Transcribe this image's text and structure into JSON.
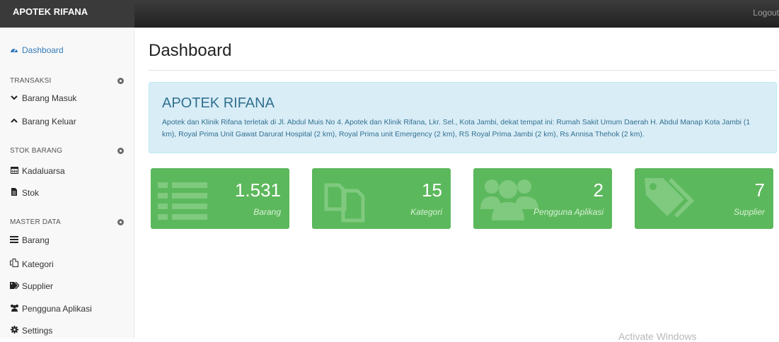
{
  "navbar": {
    "brand": "APOTEK RIFANA",
    "logout": "Logout"
  },
  "sidebar": {
    "dashboard": "Dashboard",
    "sections": [
      {
        "heading": "TRANSAKSI",
        "items": [
          "Barang Masuk",
          "Barang Keluar"
        ]
      },
      {
        "heading": "STOK BARANG",
        "items": [
          "Kadaluarsa",
          "Stok"
        ]
      },
      {
        "heading": "MASTER DATA",
        "items": [
          "Barang",
          "Kategori",
          "Supplier",
          "Pengguna Aplikasi",
          "Settings"
        ]
      }
    ]
  },
  "main": {
    "title": "Dashboard",
    "info": {
      "title": "APOTEK RIFANA",
      "text": "Apotek dan Klinik Rifana terletak di Jl. Abdul Muis No 4. Apotek dan Klinik Rifana, Lkr. Sel., Kota Jambi, dekat tempat ini: Rumah Sakit Umum Daerah H. Abdul Manap Kota Jambi (1 km), Royal Prima Unit Gawat Darurat Hospital (2 km), Royal Prima unit Emergency (2 km), RS Royal Prima Jambi (2 km), Rs Annisa Thehok (2 km)."
    },
    "cards": [
      {
        "value": "1.531",
        "label": "Barang",
        "icon": "list-icon"
      },
      {
        "value": "15",
        "label": "Kategori",
        "icon": "copy-icon"
      },
      {
        "value": "2",
        "label": "Pengguna Aplikasi",
        "icon": "users-icon"
      },
      {
        "value": "7",
        "label": "Supplier",
        "icon": "tags-icon"
      }
    ]
  },
  "watermark": "Activate Windows",
  "colors": {
    "card": "#5cb85c",
    "info_bg": "#d9edf7",
    "info_text": "#31708f",
    "link": "#337ab7",
    "navbar": "#222222"
  }
}
